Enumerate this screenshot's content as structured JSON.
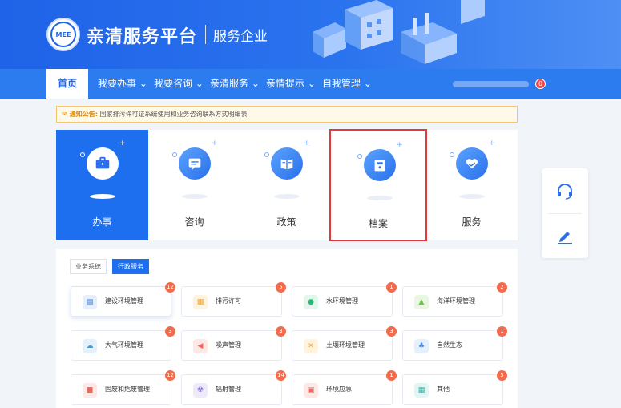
{
  "header": {
    "logo_text": "MEE",
    "title": "亲清服务平台",
    "subtitle": "服务企业"
  },
  "nav": {
    "items": [
      {
        "label": "首页",
        "active": true
      },
      {
        "label": "我要办事"
      },
      {
        "label": "我要咨询"
      },
      {
        "label": "亲清服务"
      },
      {
        "label": "亲情提示"
      },
      {
        "label": "自我管理"
      }
    ],
    "notification_count": "0"
  },
  "notice": {
    "label": "通知公告:",
    "text": "国家排污许可证系统使用和业务咨询联系方式明细表"
  },
  "cards": [
    {
      "label": "办事",
      "icon": "briefcase-icon",
      "active": true
    },
    {
      "label": "咨询",
      "icon": "chat-icon"
    },
    {
      "label": "政策",
      "icon": "book-icon"
    },
    {
      "label": "档案",
      "icon": "archive-icon",
      "selected": true
    },
    {
      "label": "服务",
      "icon": "heart-hand-icon"
    }
  ],
  "float_tools": [
    {
      "icon": "headset-icon"
    },
    {
      "icon": "edit-icon"
    }
  ],
  "panel": {
    "tabs": [
      {
        "label": "业务系统"
      },
      {
        "label": "行政服务",
        "active": true
      }
    ],
    "services": [
      {
        "label": "建设环境管理",
        "count": "12",
        "icon": "building-icon",
        "color": "#2f80ed"
      },
      {
        "label": "排污许可",
        "count": "5",
        "icon": "permit-icon",
        "color": "#f5a623"
      },
      {
        "label": "水环境管理",
        "count": "1",
        "icon": "water-drop-icon",
        "color": "#2bb673"
      },
      {
        "label": "海洋环境管理",
        "count": "2",
        "icon": "ocean-icon",
        "color": "#6fbf4b"
      },
      {
        "label": "大气环境管理",
        "count": "3",
        "icon": "cloud-icon",
        "color": "#3aa0e8"
      },
      {
        "label": "噪声管理",
        "count": "3",
        "icon": "speaker-icon",
        "color": "#f0665a"
      },
      {
        "label": "土壤环境管理",
        "count": "3",
        "icon": "soil-icon",
        "color": "#f5a623"
      },
      {
        "label": "自然生态",
        "count": "1",
        "icon": "forest-icon",
        "color": "#4a8ff0"
      },
      {
        "label": "固废和危废管理",
        "count": "12",
        "icon": "waste-icon",
        "color": "#f0665a"
      },
      {
        "label": "辐射管理",
        "count": "14",
        "icon": "radiation-icon",
        "color": "#8a6be8"
      },
      {
        "label": "环境应急",
        "count": "1",
        "icon": "alert-monitor-icon",
        "color": "#f0665a"
      },
      {
        "label": "其他",
        "count": "5",
        "icon": "grid-icon",
        "color": "#2bb6a8"
      }
    ]
  }
}
